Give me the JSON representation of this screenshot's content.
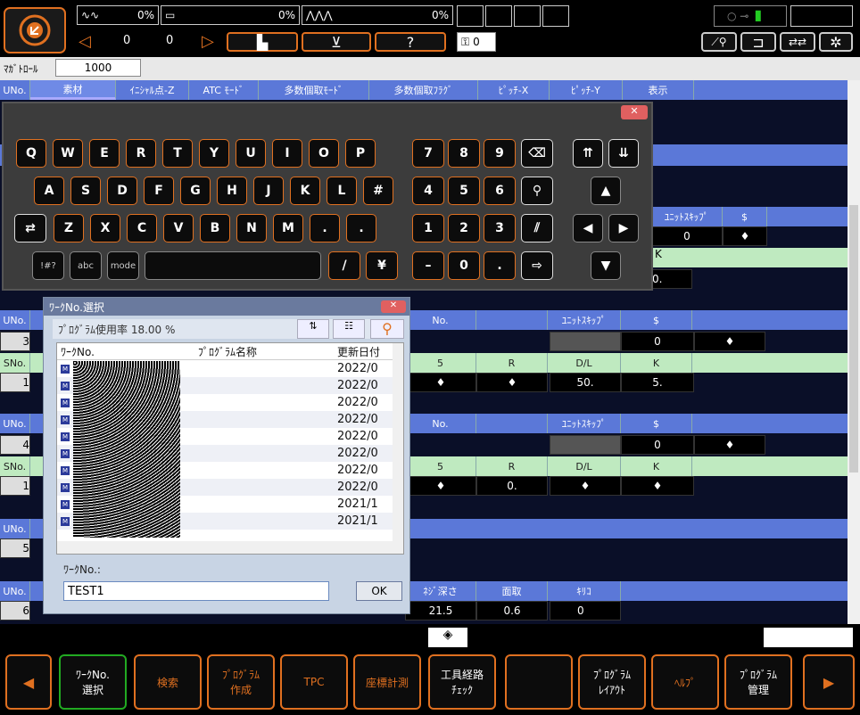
{
  "top": {
    "load1": "0%",
    "load2": "0%",
    "load3": "0%",
    "counter_a": "0",
    "counter_b": "0",
    "question": "?",
    "tool_count": "0",
    "mag_label": "ﾏｶﾞﾄﾛｰﾙ",
    "mag_value": "1000"
  },
  "header": {
    "cols": [
      "UNo.",
      "素材",
      "ｲﾆｼｬﾙ点-Z",
      "ATC ﾓｰﾄﾞ",
      "多数個取ﾓｰﾄﾞ",
      "多数個取ﾌﾗｸﾞ",
      "ﾋﾟｯﾁ-X",
      "ﾋﾟｯﾁ-Y",
      "表示"
    ]
  },
  "rows": {
    "unit_skip": "ﾕﾆｯﾄｽｷｯﾌﾟ",
    "dollar": "$",
    "zero": "0",
    "k": "K",
    "no": "No.",
    "sno": "SNo.",
    "uno": "UNo.",
    "five": "5",
    "r": "R",
    "dl": "D/L",
    "fifty": "50.",
    "five_dot": "5.",
    "zero_dot": "0.",
    "d_dot": "0.",
    "r4": "4",
    "r1": "1",
    "r3": "3",
    "r5": "5",
    "r6": "6",
    "neji": "ﾈｼﾞ深さ",
    "mentori": "面取",
    "kiri": "ｷﾘｺ",
    "v215": "21.5",
    "v06": "0.6",
    "v0": "0",
    "diamond": "♦"
  },
  "keyboard": {
    "row1": [
      "Q",
      "W",
      "E",
      "R",
      "T",
      "Y",
      "U",
      "I",
      "O",
      "P"
    ],
    "row2": [
      "A",
      "S",
      "D",
      "F",
      "G",
      "H",
      "J",
      "K",
      "L",
      "#"
    ],
    "row3": [
      "Z",
      "X",
      "C",
      "V",
      "B",
      "N",
      "M",
      ".",
      "."
    ],
    "nums1": [
      "7",
      "8",
      "9"
    ],
    "nums2": [
      "4",
      "5",
      "6"
    ],
    "nums3": [
      "1",
      "2",
      "3"
    ],
    "sym": "!#?",
    "abc": "abc",
    "mode": "mode",
    "slash": "/",
    "yen": "¥",
    "minus": "–",
    "zero": "0",
    "dot": "."
  },
  "dialog": {
    "title": "ﾜｰｸNo.選択",
    "usage": "ﾌﾟﾛｸﾞﾗﾑ使用率 18.00 %",
    "col_work": "ﾜｰｸNo.",
    "col_prog": "ﾌﾟﾛｸﾞﾗﾑ名称",
    "col_date": "更新日付",
    "dates": [
      "2022/0",
      "2022/0",
      "2022/0",
      "2022/0",
      "2022/0",
      "2022/0",
      "2022/0",
      "2022/0",
      "2021/1",
      "2021/1"
    ],
    "input_label": "ﾜｰｸNo.:",
    "input_value": "TEST1",
    "ok": "OK"
  },
  "fkeys": [
    "ﾜｰｸNo.\n選択",
    "検索",
    "ﾌﾟﾛｸﾞﾗﾑ\n作成",
    "TPC",
    "座標計測",
    "工具経路\nﾁｪｯｸ",
    "",
    "ﾌﾟﾛｸﾞﾗﾑ\nﾚｲｱｳﾄ",
    "ﾍﾙﾌﾟ",
    "ﾌﾟﾛｸﾞﾗﾑ\n管理"
  ]
}
